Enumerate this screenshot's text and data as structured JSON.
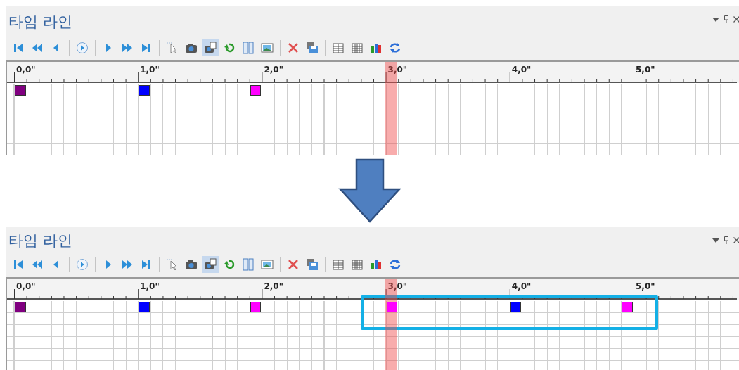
{
  "panels": [
    {
      "title": "타임 라인",
      "toolbar": [
        {
          "kind": "skip_start",
          "selected": false
        },
        {
          "kind": "rewind",
          "selected": false
        },
        {
          "kind": "step_back",
          "selected": false
        },
        {
          "kind": "separator"
        },
        {
          "kind": "play_circle",
          "selected": false
        },
        {
          "kind": "separator"
        },
        {
          "kind": "play",
          "selected": false
        },
        {
          "kind": "fast_forward",
          "selected": false
        },
        {
          "kind": "skip_end",
          "selected": false
        },
        {
          "kind": "separator"
        },
        {
          "kind": "select",
          "selected": false
        },
        {
          "kind": "camera",
          "selected": false
        },
        {
          "kind": "snapshot",
          "selected": true
        },
        {
          "kind": "undo",
          "selected": false
        },
        {
          "kind": "columns",
          "selected": false
        },
        {
          "kind": "image",
          "selected": false
        },
        {
          "kind": "separator"
        },
        {
          "kind": "delete",
          "selected": false
        },
        {
          "kind": "save",
          "selected": false
        },
        {
          "kind": "separator"
        },
        {
          "kind": "table",
          "selected": false
        },
        {
          "kind": "grid",
          "selected": false
        },
        {
          "kind": "chart",
          "selected": false
        },
        {
          "kind": "refresh",
          "selected": false
        }
      ],
      "ruler_labels": [
        "0,0\"",
        "1,0\"",
        "2,0\"",
        "3,0\"",
        "4,0\"",
        "5,0\""
      ],
      "playhead": {
        "level": 0.5
      },
      "keyframes": [
        {
          "level": 0,
          "color": "#800080"
        },
        {
          "level": 0.1667,
          "color": "#0000ff"
        },
        {
          "level": 0.3167,
          "color": "#ff00ff"
        }
      ]
    },
    {
      "title": "타임 라인",
      "toolbar": [
        {
          "kind": "skip_start",
          "selected": false
        },
        {
          "kind": "rewind",
          "selected": false
        },
        {
          "kind": "step_back",
          "selected": false
        },
        {
          "kind": "separator"
        },
        {
          "kind": "play_circle",
          "selected": false
        },
        {
          "kind": "separator"
        },
        {
          "kind": "play",
          "selected": false
        },
        {
          "kind": "fast_forward",
          "selected": false
        },
        {
          "kind": "skip_end",
          "selected": false
        },
        {
          "kind": "separator"
        },
        {
          "kind": "select",
          "selected": false
        },
        {
          "kind": "camera",
          "selected": false
        },
        {
          "kind": "snapshot",
          "selected": true
        },
        {
          "kind": "undo",
          "selected": false
        },
        {
          "kind": "columns",
          "selected": false
        },
        {
          "kind": "image",
          "selected": false
        },
        {
          "kind": "separator"
        },
        {
          "kind": "delete",
          "selected": false
        },
        {
          "kind": "save",
          "selected": false
        },
        {
          "kind": "separator"
        },
        {
          "kind": "table",
          "selected": false
        },
        {
          "kind": "grid",
          "selected": false
        },
        {
          "kind": "chart",
          "selected": false
        },
        {
          "kind": "refresh",
          "selected": false
        }
      ],
      "ruler_labels": [
        "0,0\"",
        "1,0\"",
        "2,0\"",
        "3,0\"",
        "4,0\"",
        "5,0\""
      ],
      "playhead": {
        "level": 0.5
      },
      "keyframes": [
        {
          "level": 0,
          "color": "#800080"
        },
        {
          "level": 0.1667,
          "color": "#0000ff"
        },
        {
          "level": 0.3167,
          "color": "#ff00ff"
        }
      ],
      "boxed_keyframes": [
        {
          "level": 0.5,
          "color": "#ff00ff"
        },
        {
          "level": 0.6667,
          "color": "#0000ff"
        },
        {
          "level": 0.8167,
          "color": "#ff00ff"
        }
      ]
    }
  ]
}
